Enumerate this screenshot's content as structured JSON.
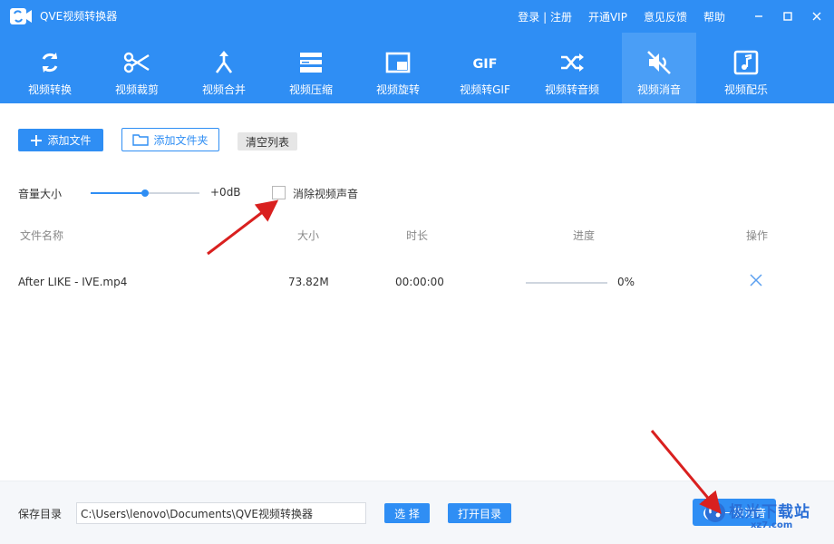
{
  "window": {
    "title": "QVE视频转换器",
    "links": [
      "登录 | 注册",
      "开通VIP",
      "意见反馈",
      "帮助"
    ],
    "controls": [
      "minimize",
      "maximize",
      "close"
    ]
  },
  "toolbar": {
    "items": [
      {
        "label": "视频转换",
        "icon": "refresh-icon"
      },
      {
        "label": "视频裁剪",
        "icon": "scissors-icon"
      },
      {
        "label": "视频合并",
        "icon": "merge-icon"
      },
      {
        "label": "视频压缩",
        "icon": "compress-icon"
      },
      {
        "label": "视频旋转",
        "icon": "rotate-icon"
      },
      {
        "label": "视频转GIF",
        "icon": "gif-icon"
      },
      {
        "label": "视频转音频",
        "icon": "shuffle-icon"
      },
      {
        "label": "视频消音",
        "icon": "mute-icon"
      },
      {
        "label": "视频配乐",
        "icon": "music-icon"
      }
    ],
    "active_label": "视频消音",
    "gif_glyph": "GIF"
  },
  "actions": {
    "add_file": "添加文件",
    "add_folder": "添加文件夹",
    "clear_list": "清空列表"
  },
  "volume": {
    "label": "音量大小",
    "value_text": "+0dB",
    "level": 0.5
  },
  "mute_option": {
    "label": "消除视频声音",
    "checked": false
  },
  "table": {
    "headers": [
      "文件名称",
      "大小",
      "时长",
      "进度",
      "操作"
    ],
    "rows": [
      {
        "name": "After LIKE - IVE.mp4",
        "size": "73.82M",
        "duration": "00:00:00",
        "progress": 0,
        "progress_text": "0%"
      }
    ]
  },
  "bottom": {
    "save_label": "保存目录",
    "save_path": "C:\\Users\\lenovo\\Documents\\QVE视频转换器",
    "choose_label": "选 择",
    "open_dir_label": "打开目录",
    "start_label": "一键消音"
  },
  "watermark": {
    "text": "极光下载站",
    "sub": "xz7.com"
  },
  "colors": {
    "accent": "#2f8ef4",
    "annotation_arrow": "#d9201f"
  }
}
